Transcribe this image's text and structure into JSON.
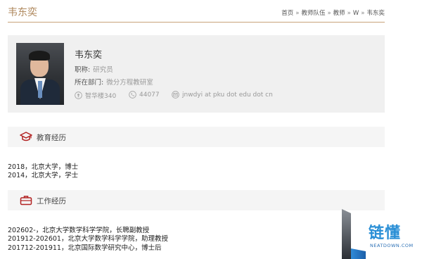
{
  "page": {
    "title": "韦东奕"
  },
  "breadcrumb": [
    "首页",
    "教师队伍",
    "教师",
    "W",
    "韦东奕"
  ],
  "breadcrumb_sep": "»",
  "profile": {
    "name": "韦东奕",
    "title_label": "职称:",
    "title_value": "研究员",
    "dept_label": "所在部门:",
    "dept_value": "微分方程教研室",
    "office": "智华楼340",
    "phone": "44077",
    "email": "jnwdyi at pku dot edu dot cn"
  },
  "education": {
    "heading": "教育经历",
    "items": [
      "2018，北京大学，博士",
      "2014，北京大学，学士"
    ]
  },
  "work": {
    "heading": "工作经历",
    "items": [
      "202602-，北京大学数学科学学院，长聘副教授",
      "201912-202601，北京大学数学科学学院，助理教授",
      "201712-201911，北京国际数学研究中心，博士后"
    ]
  },
  "watermark": {
    "brand": "链懂",
    "domain": "NEATDOWN.COM"
  },
  "colors": {
    "accent": "#b08a5f",
    "rule": "#c8a37a",
    "section_icon": "#b22222",
    "card_bg": "#f0f0f0"
  }
}
